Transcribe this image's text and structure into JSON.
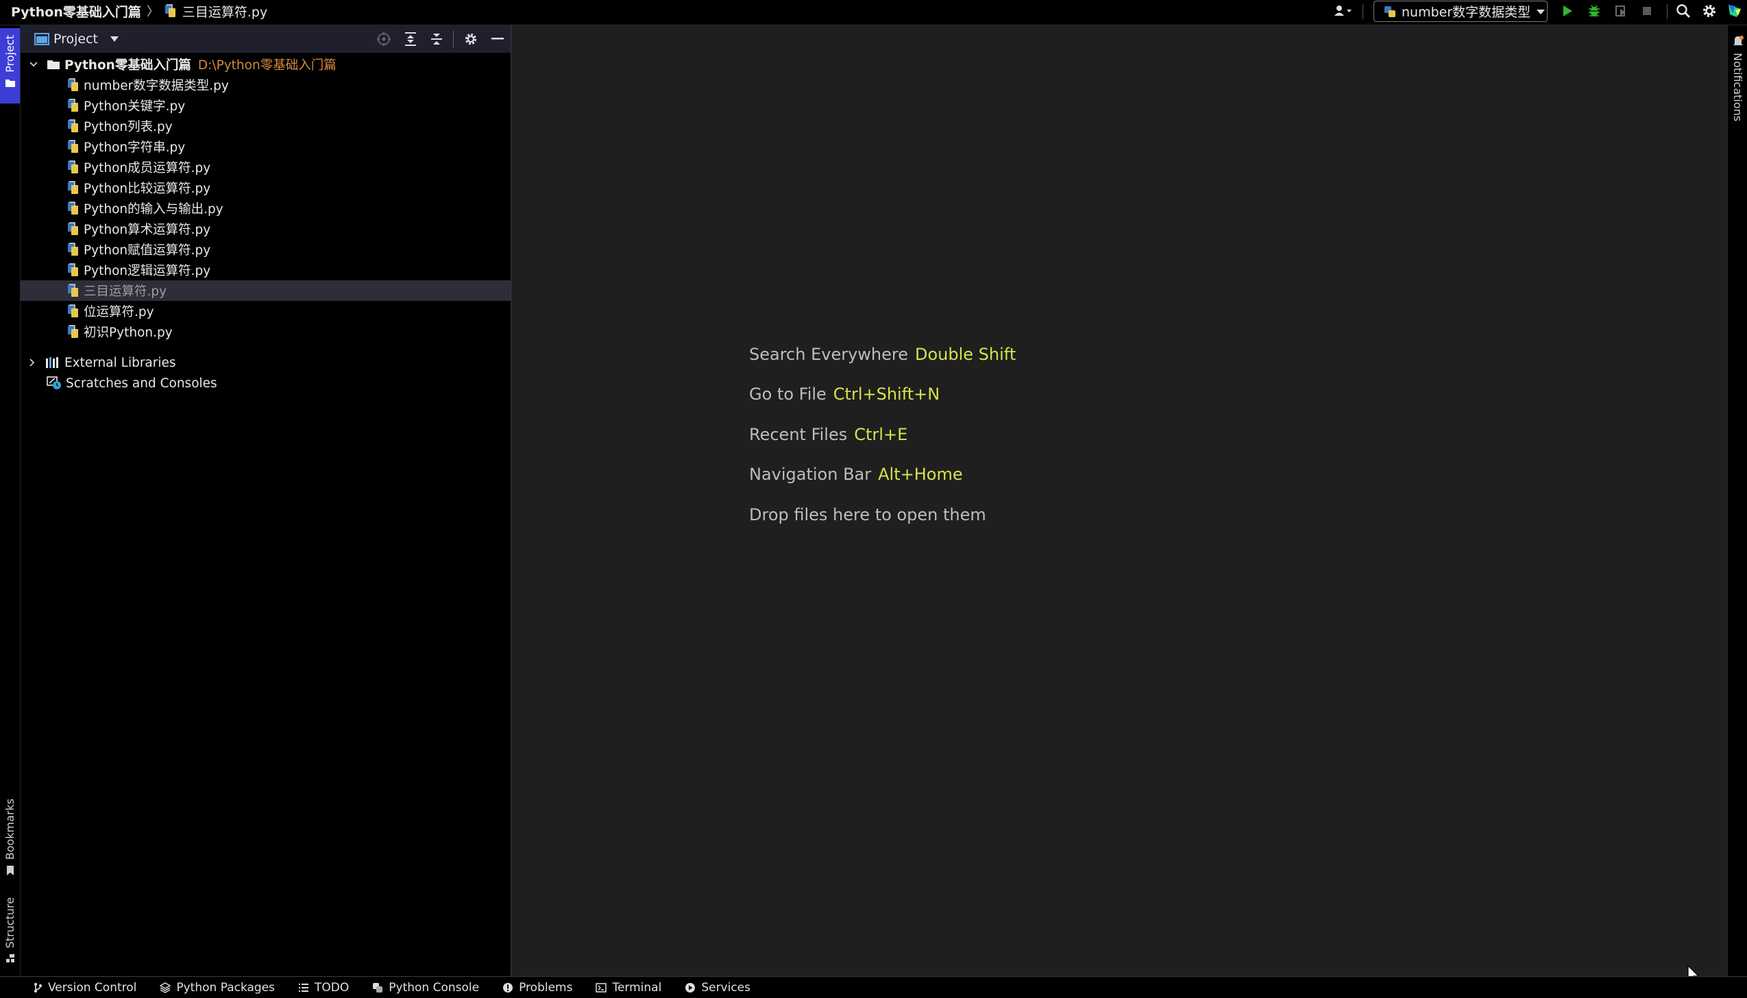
{
  "breadcrumb": {
    "project": "Python零基础入门篇",
    "file": "三目运算符.py"
  },
  "toolbar": {
    "run_config": "number数字数据类型",
    "icons": [
      "user-icon",
      "run-icon",
      "debug-icon",
      "coverage-icon",
      "stop-icon",
      "search-icon",
      "gear-icon",
      "jetbrains-logo-icon"
    ]
  },
  "left_stripe": {
    "project_tab": "Project",
    "bookmarks_tab": "Bookmarks",
    "structure_tab": "Structure"
  },
  "right_stripe": {
    "notifications_tab": "Notifications"
  },
  "project_panel": {
    "title": "Project",
    "root": {
      "name": "Python零基础入门篇",
      "path": "D:\\Python零基础入门篇"
    },
    "files": [
      "number数字数据类型.py",
      "Python关键字.py",
      "Python列表.py",
      "Python字符串.py",
      "Python成员运算符.py",
      "Python比较运算符.py",
      "Python的输入与输出.py",
      "Python算术运算符.py",
      "Python赋值运算符.py",
      "Python逻辑运算符.py",
      "三目运算符.py",
      "位运算符.py",
      "初识Python.py"
    ],
    "selected_file": "三目运算符.py",
    "external_libraries": "External Libraries",
    "scratches": "Scratches and Consoles"
  },
  "editor": {
    "hints": [
      {
        "label": "Search Everywhere",
        "key": "Double Shift"
      },
      {
        "label": "Go to File",
        "key": "Ctrl+Shift+N"
      },
      {
        "label": "Recent Files",
        "key": "Ctrl+E"
      },
      {
        "label": "Navigation Bar",
        "key": "Alt+Home"
      }
    ],
    "drop_text": "Drop files here to open them"
  },
  "bottom_bar": {
    "items": [
      "Version Control",
      "Python Packages",
      "TODO",
      "Python Console",
      "Problems",
      "Terminal",
      "Services"
    ]
  },
  "colors": {
    "accent": "#3d3dd8",
    "shortcut": "#d6e34a",
    "path": "#d48a3b",
    "editor_bg": "#1f1f1f"
  }
}
